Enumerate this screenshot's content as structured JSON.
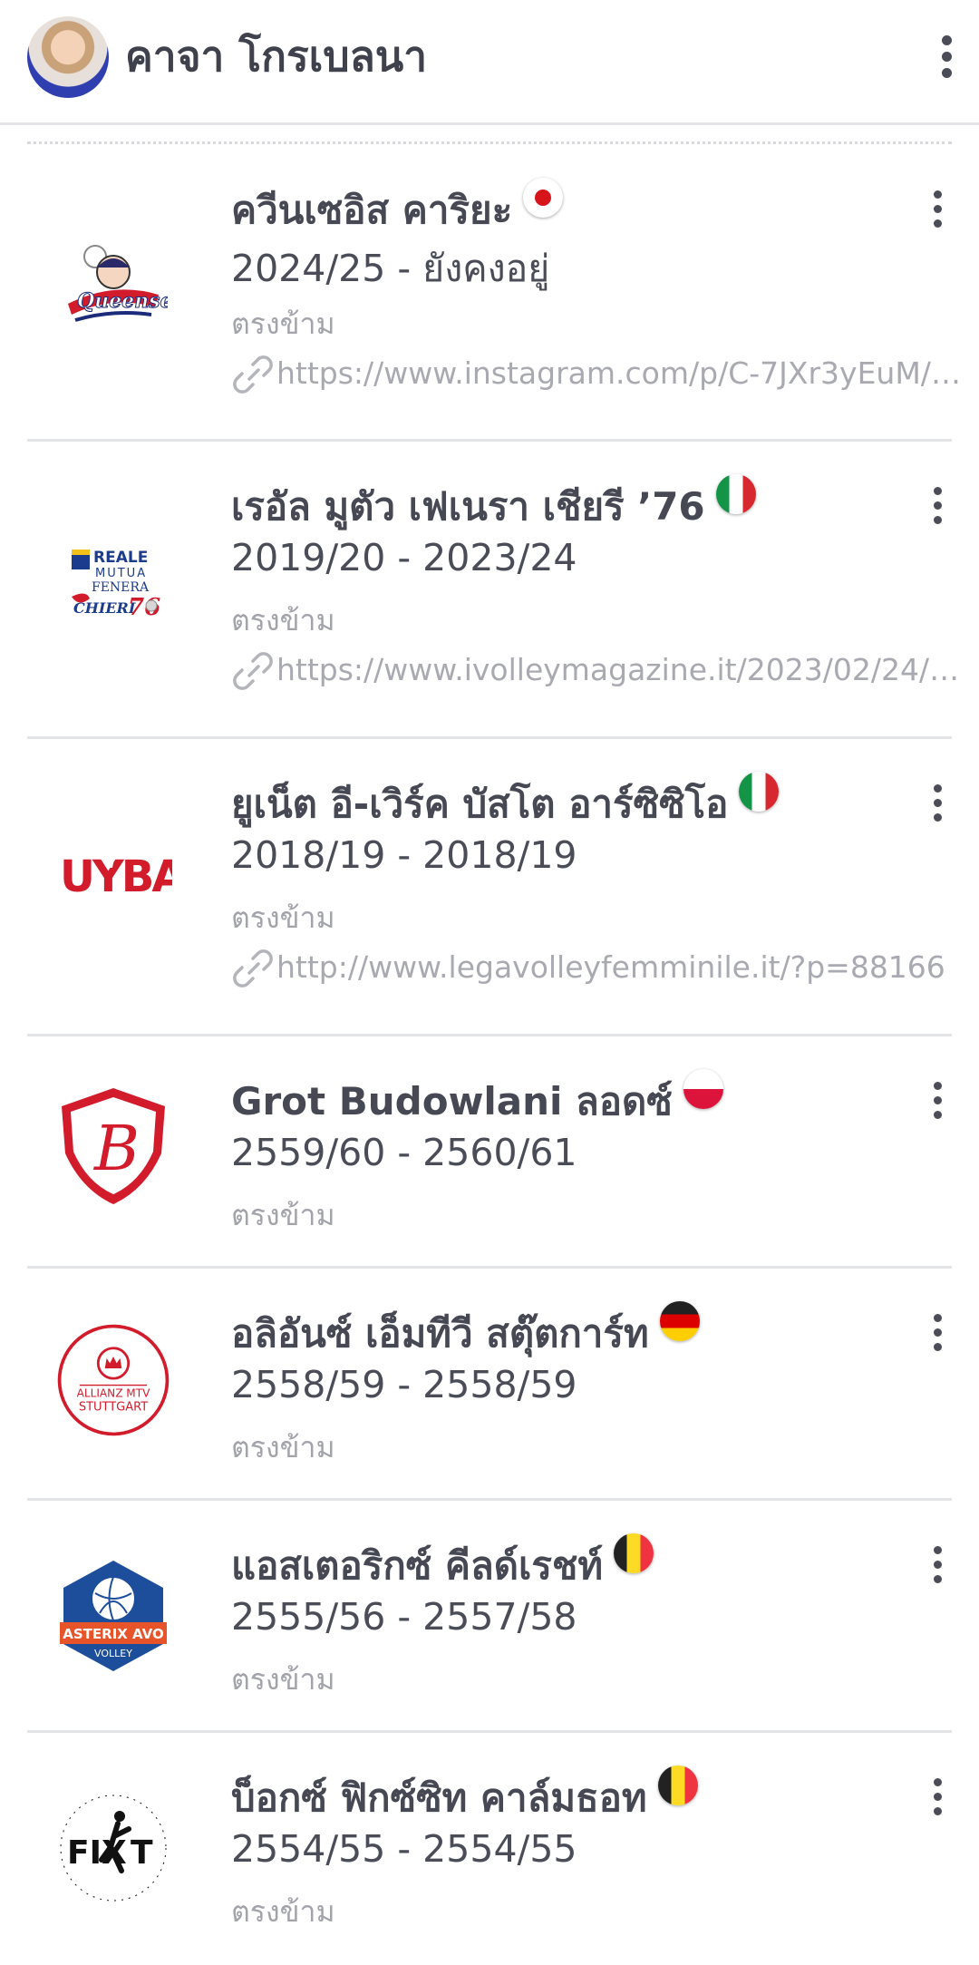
{
  "header": {
    "title": "คาจา โกรเบลนา",
    "avatar_icon": "player-avatar",
    "menu_icon": "more-vertical-icon"
  },
  "clubs": [
    {
      "name": "ควีนเซอิส คาริยะ",
      "flag": "japan",
      "years": "2024/25 - ยังคงอยู่",
      "status": "ตรงข้าม",
      "url": "https://www.instagram.com/p/C-7JXr3yEuM/?igsh=MTBnN2R4ZmFpNzRpbA=="
    },
    {
      "name": "เรอัล มูตัว เฟเนรา เชียรี ’76",
      "flag": "italy",
      "years": "2019/20 - 2023/24",
      "status": "ตรงข้าม",
      "url": "https://www.ivolleymagazine.it/2023/02/24/pallavolo-a1-femminile-chieri"
    },
    {
      "name": "ยูเน็ต อี-เวิร์ค บัสโต อาร์ซิซิโอ",
      "flag": "italy",
      "years": "2018/19 - 2018/19",
      "status": "ตรงข้าม",
      "url": "http://www.legavolleyfemminile.it/?p=88166"
    },
    {
      "name": "Grot Budowlani ลอดซ์",
      "flag": "poland",
      "years": "2559/60 - 2560/61",
      "status": "ตรงข้าม",
      "url": ""
    },
    {
      "name": "อลิอันซ์ เอ็มทีวี สตุ๊ตการ์ท",
      "flag": "germany",
      "years": "2558/59 - 2558/59",
      "status": "ตรงข้าม",
      "url": "",
      "logo_text": "ALLIANZ MTV STUTTGART"
    },
    {
      "name": "แอสเตอริกซ์ คีลด์เรชท์",
      "flag": "belgium",
      "years": "2555/56 - 2557/58",
      "status": "ตรงข้าม",
      "url": "",
      "logo_text": "ASTERIX AVO VOLLEY"
    },
    {
      "name": "บ็อกซ์ ฟิกซ์ซิท คาล์มธอท",
      "flag": "belgium",
      "years": "2554/55 - 2554/55",
      "status": "ตรงข้าม",
      "url": "",
      "logo_text": "FIXIT"
    }
  ]
}
